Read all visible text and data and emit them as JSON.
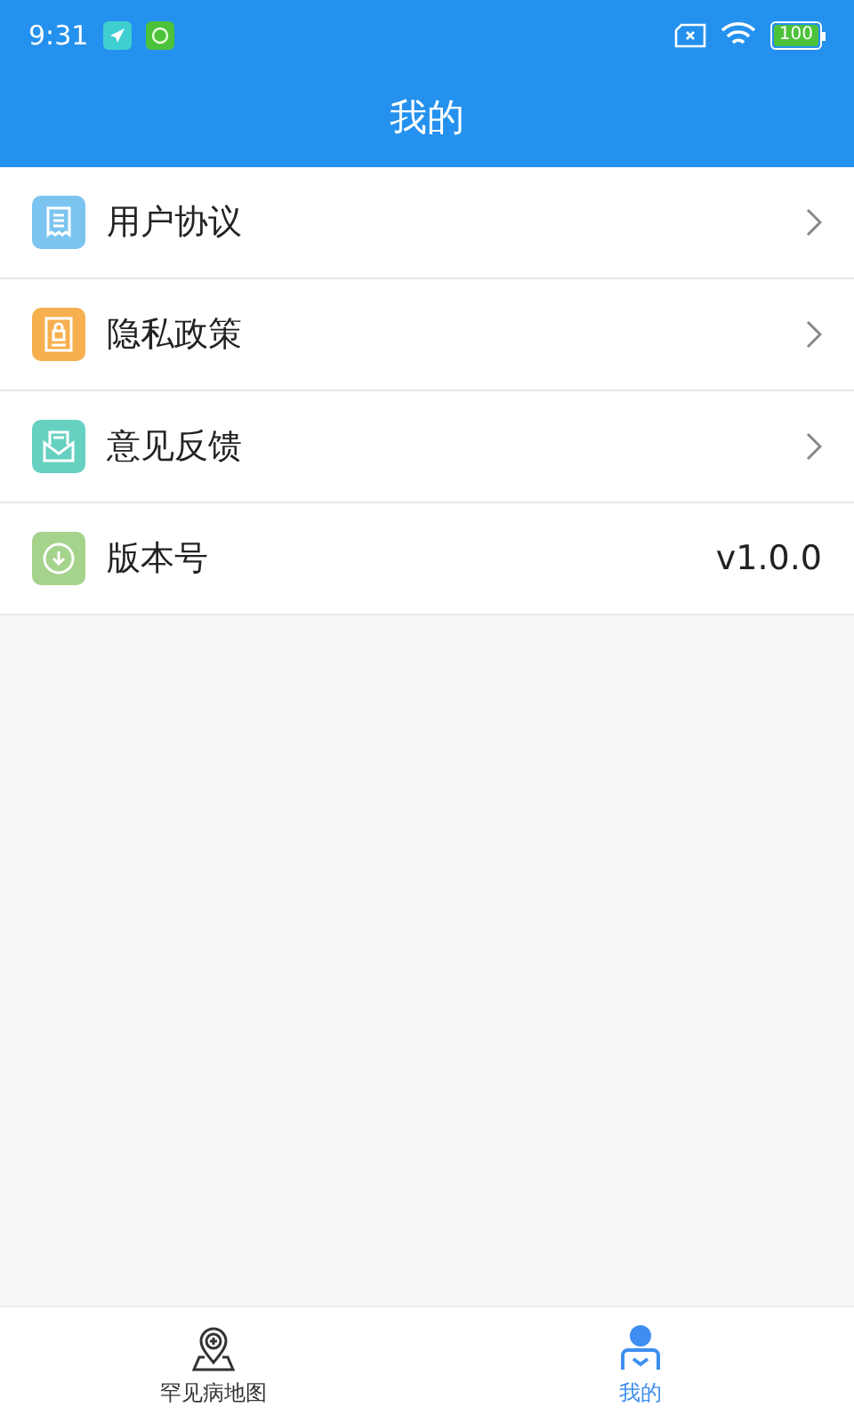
{
  "status_bar": {
    "time": "9:31",
    "battery": "100"
  },
  "header": {
    "title": "我的"
  },
  "menu": [
    {
      "label": "用户协议",
      "kind": "link",
      "color": "#7cc4f0"
    },
    {
      "label": "隐私政策",
      "kind": "link",
      "color": "#f6b04f"
    },
    {
      "label": "意见反馈",
      "kind": "link",
      "color": "#66d1c1"
    },
    {
      "label": "版本号",
      "kind": "value",
      "value": "v1.0.0",
      "color": "#a6d38c"
    }
  ],
  "tab_bar": [
    {
      "label": "罕见病地图",
      "selected": false
    },
    {
      "label": "我的",
      "selected": true
    }
  ]
}
